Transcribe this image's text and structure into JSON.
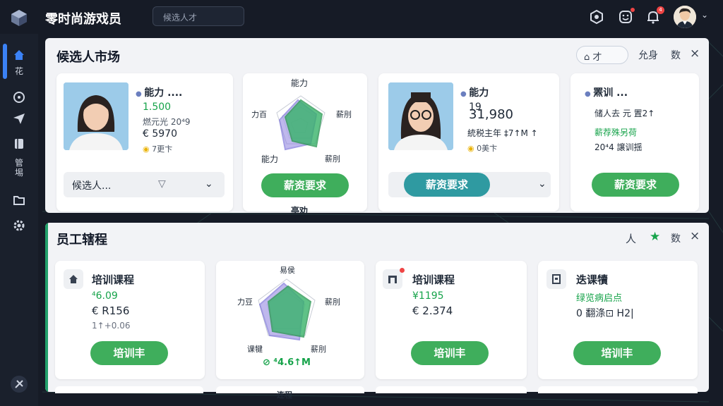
{
  "app": {
    "title": "零时尚游戏员",
    "search_placeholder": "候选人才",
    "notification_count": "4"
  },
  "sidebar": {
    "items": [
      {
        "icon": "home-icon"
      },
      {
        "label": "花"
      },
      {
        "icon": "gamepad-icon"
      },
      {
        "icon": "send-icon"
      },
      {
        "icon": "book-icon"
      },
      {
        "label": "管\n埸"
      },
      {
        "icon": "folder-icon"
      },
      {
        "icon": "gear-icon"
      },
      {
        "icon": "tools-icon"
      }
    ]
  },
  "market": {
    "title": "候选人市场",
    "pill_label": "才",
    "header_text": "允身",
    "header_extra": "数",
    "close": "×",
    "card1": {
      "name": "能力 ....",
      "value1": "1.500",
      "line2": "燃元光 20⁴9",
      "value3": "€ 5970",
      "line4": "7更卞",
      "select": "候选人..."
    },
    "radar1": {
      "top": "能力",
      "left": "力百",
      "right": "薪刖",
      "bottom_left": "能力",
      "bottom_right": "薪刖",
      "button": "薪资要求",
      "below": "亭劝"
    },
    "card2": {
      "name": "能力",
      "value1": "19",
      "value2": "31,980",
      "line3": "統税主年 ‡7↑M ↑",
      "line4": "0美卞",
      "button": "薪资要求"
    },
    "card3": {
      "name": "罴训 ...",
      "line2": "储人去 元 置2↑",
      "line3": "薪荐殊另荷",
      "line4": "20⁴4 譲训揺",
      "button": "薪资要求"
    }
  },
  "staff": {
    "title": "员工辖程",
    "header_person": "人",
    "header_extra": "数",
    "close": "×",
    "card1": {
      "title": "培训课程",
      "value1": "⁴6.09",
      "value2": "€ R156",
      "line3": "1↑+0.06",
      "button": "培训丰"
    },
    "radar": {
      "top": "易侯",
      "left": "力豆",
      "right": "薪刖",
      "bottom_left": "课犍",
      "bottom_right": "薪刖",
      "stat": "⁴4.6↑M"
    },
    "card2": {
      "title": "培训课程",
      "value1": "¥1195",
      "value2": "€ 2.374",
      "button": "培训丰"
    },
    "card3": {
      "title": "迭课犢",
      "line2": "绿览病启点",
      "line3": "0 翻涤⊡ H2|",
      "button": "培训丰"
    },
    "strip_label": "连程"
  }
}
